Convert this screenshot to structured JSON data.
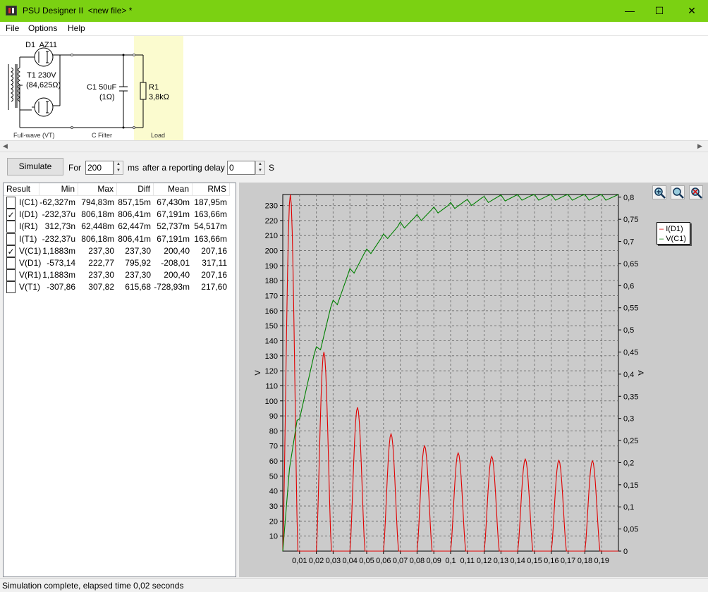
{
  "window": {
    "title": "PSU Designer II  <new file> *",
    "minimize_glyph": "—",
    "maximize_glyph": "☐",
    "close_glyph": "✕"
  },
  "menu": [
    "File",
    "Options",
    "Help"
  ],
  "schematic": {
    "rectifier_label": "D1  AZ11",
    "transformer_label": "T1 230V",
    "transformer_res": "(84,625Ω)",
    "cap_label": "C1 50uF",
    "cap_res": "(1Ω)",
    "load_label": "R1",
    "load_value": "3,8kΩ",
    "section_fullwave": "Full-wave (VT)",
    "section_filter": "C Filter",
    "section_load": "Load",
    "load_highlight": "#fbfbcf"
  },
  "toolbar": {
    "simulate": "Simulate",
    "for": "For",
    "duration": "200",
    "ms": "ms",
    "delay_text": "after a reporting delay of",
    "delay": "0",
    "s": "S"
  },
  "results": {
    "headers": [
      "Result",
      "Min",
      "Max",
      "Diff",
      "Mean",
      "RMS"
    ],
    "rows": [
      {
        "checked": false,
        "name": "I(C1)",
        "min": "-62,327m",
        "max": "794,83m",
        "diff": "857,15m",
        "mean": "67,430m",
        "rms": "187,95m"
      },
      {
        "checked": true,
        "name": "I(D1)",
        "min": "-232,37u",
        "max": "806,18m",
        "diff": "806,41m",
        "mean": "67,191m",
        "rms": "163,66m"
      },
      {
        "checked": false,
        "name": "I(R1)",
        "min": "312,73n",
        "max": "62,448m",
        "diff": "62,447m",
        "mean": "52,737m",
        "rms": "54,517m"
      },
      {
        "checked": false,
        "name": "I(T1)",
        "min": "-232,37u",
        "max": "806,18m",
        "diff": "806,41m",
        "mean": "67,191m",
        "rms": "163,66m"
      },
      {
        "checked": true,
        "name": "V(C1)",
        "min": "1,1883m",
        "max": "237,30",
        "diff": "237,30",
        "mean": "200,40",
        "rms": "207,16"
      },
      {
        "checked": false,
        "name": "V(D1)",
        "min": "-573,14",
        "max": "222,77",
        "diff": "795,92",
        "mean": "-208,01",
        "rms": "317,11"
      },
      {
        "checked": false,
        "name": "V(R1)",
        "min": "1,1883m",
        "max": "237,30",
        "diff": "237,30",
        "mean": "200,40",
        "rms": "207,16"
      },
      {
        "checked": false,
        "name": "V(T1)",
        "min": "-307,86",
        "max": "307,82",
        "diff": "615,68",
        "mean": "-728,93m",
        "rms": "217,60"
      }
    ]
  },
  "plot_tools": [
    "zoom-in-icon",
    "zoom-fit-icon",
    "zoom-reset-icon"
  ],
  "chart_data": {
    "type": "line",
    "x_ticks": [
      "0,01",
      "0,02",
      "0,03",
      "0,04",
      "0,05",
      "0,06",
      "0,07",
      "0,08",
      "0,09",
      "0,1",
      "0,11",
      "0,12",
      "0,13",
      "0,14",
      "0,15",
      "0,16",
      "0,17",
      "0,18",
      "0,19"
    ],
    "xlim": [
      0,
      0.2
    ],
    "y_left": {
      "label": "V",
      "ticks": [
        "10",
        "20",
        "30",
        "40",
        "50",
        "60",
        "70",
        "80",
        "90",
        "100",
        "110",
        "120",
        "130",
        "140",
        "150",
        "160",
        "170",
        "180",
        "190",
        "200",
        "210",
        "220",
        "230"
      ],
      "range": [
        0,
        237.3
      ]
    },
    "y_right": {
      "label": "A",
      "ticks": [
        "0",
        "0,05",
        "0,1",
        "0,15",
        "0,2",
        "0,25",
        "0,3",
        "0,35",
        "0,4",
        "0,45",
        "0,5",
        "0,55",
        "0,6",
        "0,65",
        "0,7",
        "0,75",
        "0,8"
      ],
      "range": [
        0,
        0.806
      ]
    },
    "grid": true,
    "legend_position": "top-right",
    "series": [
      {
        "name": "I(D1)",
        "color": "#e00000",
        "axis": "right",
        "peaks": [
          [
            0.0045,
            0.806
          ],
          [
            0.0245,
            0.45
          ],
          [
            0.0445,
            0.325
          ],
          [
            0.0645,
            0.265
          ],
          [
            0.0845,
            0.238
          ],
          [
            0.1045,
            0.222
          ],
          [
            0.1245,
            0.214
          ],
          [
            0.1445,
            0.208
          ],
          [
            0.1645,
            0.205
          ],
          [
            0.1845,
            0.204
          ]
        ]
      },
      {
        "name": "V(C1)",
        "color": "#008000",
        "axis": "left",
        "points": [
          [
            0,
            0
          ],
          [
            0.004,
            55
          ],
          [
            0.0085,
            87
          ],
          [
            0.01,
            88
          ],
          [
            0.0185,
            130
          ],
          [
            0.02,
            136
          ],
          [
            0.0225,
            134
          ],
          [
            0.0285,
            162
          ],
          [
            0.03,
            167
          ],
          [
            0.0325,
            164
          ],
          [
            0.0385,
            183
          ],
          [
            0.04,
            188
          ],
          [
            0.0425,
            185
          ],
          [
            0.0485,
            198
          ],
          [
            0.05,
            201
          ],
          [
            0.0525,
            198
          ],
          [
            0.0585,
            208
          ],
          [
            0.06,
            211
          ],
          [
            0.0625,
            208
          ],
          [
            0.0685,
            216
          ],
          [
            0.07,
            219
          ],
          [
            0.0725,
            215
          ],
          [
            0.0785,
            222
          ],
          [
            0.08,
            224
          ],
          [
            0.0825,
            220
          ],
          [
            0.0885,
            227
          ],
          [
            0.09,
            229
          ],
          [
            0.0925,
            225
          ],
          [
            0.0985,
            230
          ],
          [
            0.1,
            232
          ],
          [
            0.1025,
            228
          ],
          [
            0.1085,
            233
          ],
          [
            0.11,
            234
          ],
          [
            0.1125,
            230
          ],
          [
            0.1185,
            235
          ],
          [
            0.12,
            236
          ],
          [
            0.1225,
            232
          ],
          [
            0.1285,
            236
          ],
          [
            0.13,
            237
          ],
          [
            0.1325,
            233
          ],
          [
            0.1385,
            236.5
          ],
          [
            0.14,
            237.2
          ],
          [
            0.1425,
            233.5
          ],
          [
            0.1485,
            236.8
          ],
          [
            0.15,
            237.3
          ],
          [
            0.1525,
            233.5
          ],
          [
            0.1585,
            236.8
          ],
          [
            0.16,
            237.3
          ],
          [
            0.1625,
            233.5
          ],
          [
            0.1685,
            236.8
          ],
          [
            0.17,
            237.3
          ],
          [
            0.1725,
            233.5
          ],
          [
            0.1785,
            236.8
          ],
          [
            0.18,
            237.3
          ],
          [
            0.1825,
            233.5
          ],
          [
            0.1885,
            236.8
          ],
          [
            0.19,
            237.3
          ],
          [
            0.1925,
            233.5
          ],
          [
            0.2,
            237.3
          ]
        ]
      }
    ]
  },
  "status": "Simulation complete, elapsed time 0,02 seconds"
}
